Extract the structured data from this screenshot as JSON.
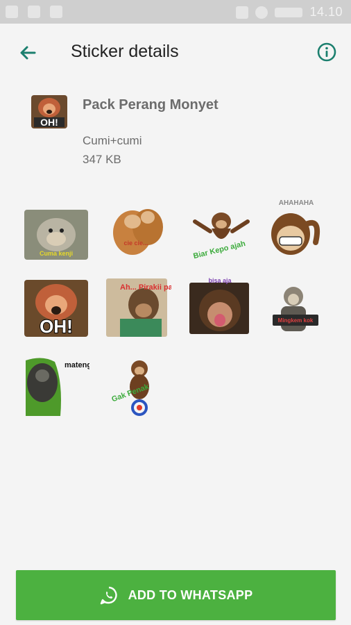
{
  "status_bar": {
    "time": "14.10"
  },
  "toolbar": {
    "title": "Sticker details"
  },
  "pack": {
    "name": "Pack Perang Monyet",
    "author": "Cumi+cumi",
    "size": "347 KB",
    "thumb_text": "OH!"
  },
  "stickers": [
    {
      "id": 1,
      "caption": "Cuma kenji"
    },
    {
      "id": 2,
      "caption": "cie cie..."
    },
    {
      "id": 3,
      "caption": "Biar Kepo ajah"
    },
    {
      "id": 4,
      "caption": "AHAHAHA"
    },
    {
      "id": 5,
      "caption": "OH!"
    },
    {
      "id": 6,
      "caption": "Ah... Pirakii pan.."
    },
    {
      "id": 7,
      "caption": "bisa aja"
    },
    {
      "id": 8,
      "caption": "Mingkem kok"
    },
    {
      "id": 9,
      "caption": "mateng kon.."
    },
    {
      "id": 10,
      "caption": "Gak Penak"
    }
  ],
  "add_button": {
    "label": "ADD TO WHATSAPP"
  },
  "colors": {
    "accent": "#1b7f6e",
    "button": "#4cb140"
  }
}
